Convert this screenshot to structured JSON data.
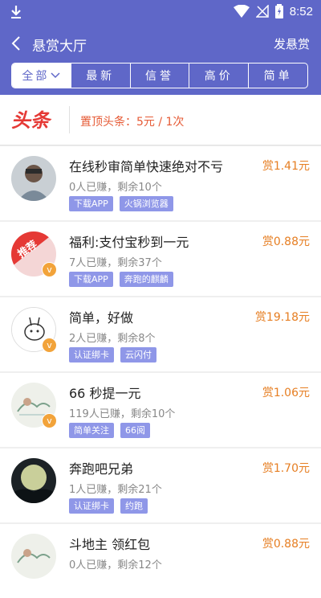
{
  "status": {
    "time": "8:52"
  },
  "header": {
    "title": "悬赏大厅",
    "action": "发悬赏"
  },
  "tabs": [
    {
      "label": "全部",
      "active": true
    },
    {
      "label": "最新"
    },
    {
      "label": "信誉"
    },
    {
      "label": "高价"
    },
    {
      "label": "简单"
    }
  ],
  "headline": {
    "logo_text": "头条",
    "text": "置顶头条：5元 / 1次"
  },
  "items": [
    {
      "title": "在线秒审简单快速绝对不亏",
      "price": "赏1.41元",
      "stats": "0人已赚，剩余10个",
      "tags": [
        "下载APP",
        "火锅浏览器"
      ],
      "vip": false
    },
    {
      "title": "福利:支付宝秒到一元",
      "price": "赏0.88元",
      "stats": "7人已赚，剩余37个",
      "tags": [
        "下载APP",
        "奔跑的麒麟"
      ],
      "vip": true,
      "avatar_text": "推荐"
    },
    {
      "title": "简单，好做",
      "price": "赏19.18元",
      "stats": "2人已赚，剩余8个",
      "tags": [
        "认证绑卡",
        "云闪付"
      ],
      "vip": true
    },
    {
      "title": "66 秒提一元",
      "price": "赏1.06元",
      "stats": "119人已赚，剩余10个",
      "tags": [
        "简单关注",
        "66阅"
      ],
      "vip": true
    },
    {
      "title": "奔跑吧兄弟",
      "price": "赏1.70元",
      "stats": "1人已赚，剩余21个",
      "tags": [
        "认证绑卡",
        "约跑"
      ],
      "vip": false
    },
    {
      "title": "斗地主 领红包",
      "price": "赏0.88元",
      "stats": "0人已赚，剩余12个",
      "tags": [],
      "vip": false
    }
  ]
}
